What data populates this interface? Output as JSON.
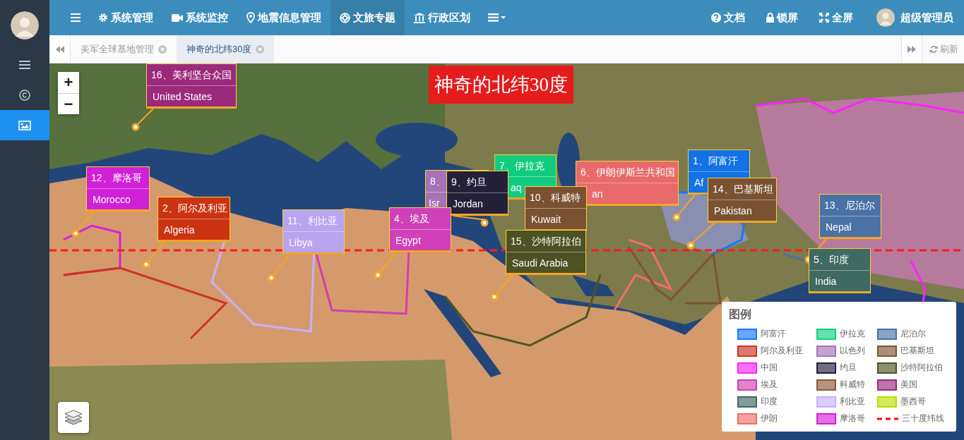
{
  "sidebar": {
    "items": [
      {
        "selected": false
      },
      {
        "selected": false
      },
      {
        "selected": true
      }
    ]
  },
  "top_nav": {
    "menu_items": [
      {
        "label": "系统管理",
        "selected": false
      },
      {
        "label": "系统监控",
        "selected": false
      },
      {
        "label": "地震信息管理",
        "selected": false
      },
      {
        "label": "文旅专题",
        "selected": true
      },
      {
        "label": "行政区划",
        "selected": false
      }
    ],
    "right_items": [
      {
        "label": "文档"
      },
      {
        "label": "锁屏"
      },
      {
        "label": "全屏"
      }
    ],
    "user": {
      "name": "超级管理员"
    }
  },
  "tabs": [
    {
      "label": "美军全球基地管理",
      "selected": false
    },
    {
      "label": "神奇的北纬30度",
      "selected": true
    }
  ],
  "refresh_button": "刷新",
  "map": {
    "title": "神奇的北纬30度",
    "zoom_in": "+",
    "zoom_out": "−",
    "popups": [
      {
        "title": "16、美利坚合众国",
        "subtitle": "United States",
        "color": "#9b2a7d"
      },
      {
        "title": "12、摩洛哥",
        "subtitle": "Morocco",
        "color": "#d020d8"
      },
      {
        "title": "2、阿尔及利亚",
        "subtitle": "Algeria",
        "color": "#cc3311"
      },
      {
        "title": "11、利比亚",
        "subtitle": "Libya",
        "color": "#b9a4f0"
      },
      {
        "title": "4、埃及",
        "subtitle": "Egypt",
        "color": "#d040b8"
      },
      {
        "title": "8、",
        "subtitle": "Isr",
        "color": "#a672b6"
      },
      {
        "title": "9、约旦",
        "subtitle": "Jordan",
        "color": "#25203a"
      },
      {
        "title": "7、伊拉克",
        "subtitle": "aq",
        "color": "#10cc80"
      },
      {
        "title": "10、科威特",
        "subtitle": "Kuwait",
        "color": "#7a5232"
      },
      {
        "title": "6、伊朗伊斯兰共和国",
        "subtitle": "an",
        "color": "#e86a6a"
      },
      {
        "title": "15、沙特阿拉伯",
        "subtitle": "Saudi Arabia",
        "color": "#4c5222"
      },
      {
        "title": "1、阿富汗",
        "subtitle": "Af",
        "color": "#1272e6"
      },
      {
        "title": "14、巴基斯坦",
        "subtitle": "Pakistan",
        "color": "#7a5232"
      },
      {
        "title": "13、尼泊尔",
        "subtitle": "Nepal",
        "color": "#4a72a6"
      },
      {
        "title": "5、印度",
        "subtitle": "India",
        "color": "#3e6a62"
      }
    ],
    "legend": {
      "title": "图例",
      "items": [
        {
          "label": "阿富汗",
          "kind": "area",
          "color": "#1677ff"
        },
        {
          "label": "伊拉克",
          "kind": "area",
          "color": "#10d080"
        },
        {
          "label": "尼泊尔",
          "kind": "area",
          "color": "#4a72a6"
        },
        {
          "label": "阿尔及利亚",
          "kind": "area",
          "color": "#cc3322"
        },
        {
          "label": "以色列",
          "kind": "area",
          "color": "#a672b6"
        },
        {
          "label": "巴基斯坦",
          "kind": "area",
          "color": "#7a5530"
        },
        {
          "label": "中国",
          "kind": "area",
          "color": "#ff22ff"
        },
        {
          "label": "约旦",
          "kind": "area",
          "color": "#25203a"
        },
        {
          "label": "沙特阿拉伯",
          "kind": "area",
          "color": "#4e5522"
        },
        {
          "label": "埃及",
          "kind": "area",
          "color": "#d040b0"
        },
        {
          "label": "科威特",
          "kind": "area",
          "color": "#8a5a38"
        },
        {
          "label": "美国",
          "kind": "area",
          "color": "#9a2a7a"
        },
        {
          "label": "印度",
          "kind": "area",
          "color": "#3e6a62"
        },
        {
          "label": "利比亚",
          "kind": "area",
          "color": "#c8b0ff"
        },
        {
          "label": "墨西哥",
          "kind": "area",
          "color": "#b8e000"
        },
        {
          "label": "伊朗",
          "kind": "area",
          "color": "#f07068"
        },
        {
          "label": "摩洛哥",
          "kind": "area",
          "color": "#d820d8"
        },
        {
          "label": "三十度纬线",
          "kind": "line",
          "color": "#ff0000"
        }
      ]
    }
  }
}
